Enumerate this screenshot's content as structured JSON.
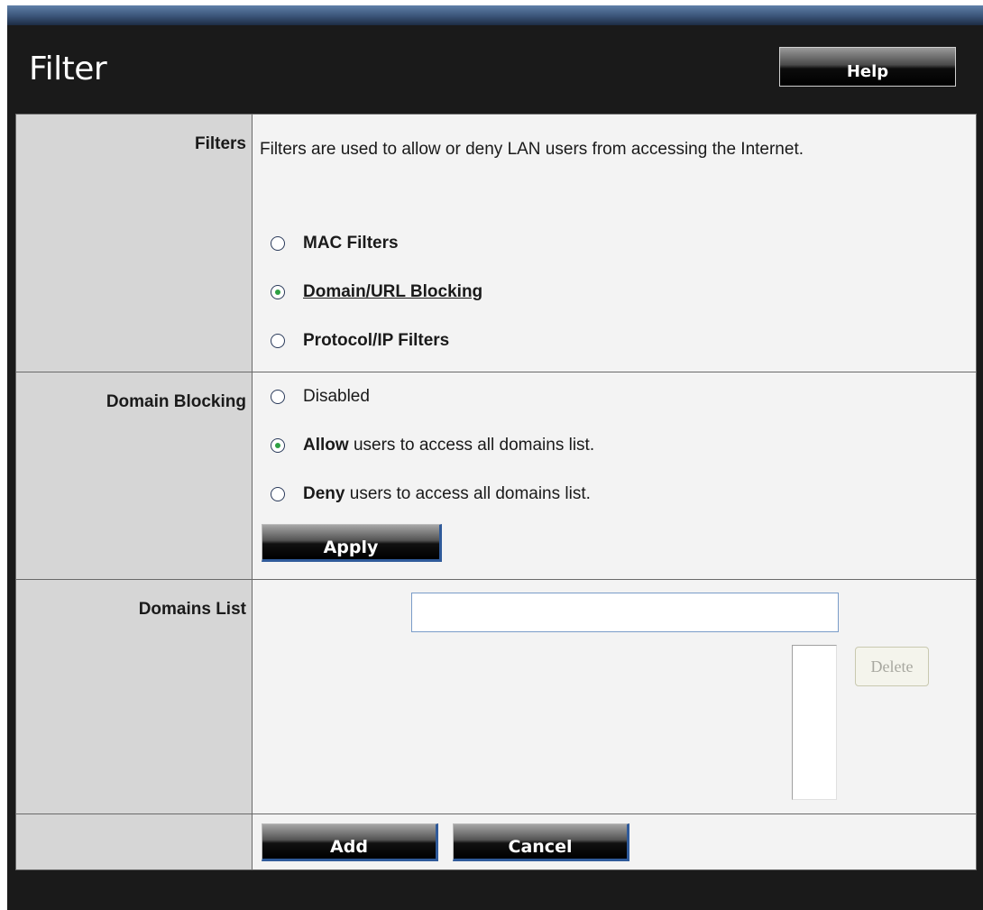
{
  "header": {
    "title": "Filter",
    "help_label": "Help"
  },
  "filters": {
    "label": "Filters",
    "description": "Filters are used to allow or deny LAN users from accessing the Internet.",
    "options": [
      {
        "label": "MAC Filters",
        "checked": false
      },
      {
        "label": "Domain/URL Blocking",
        "checked": true
      },
      {
        "label": "Protocol/IP Filters",
        "checked": false
      }
    ]
  },
  "domain_blocking": {
    "label": "Domain Blocking",
    "disabled_label": "Disabled",
    "allow_bold": "Allow",
    "allow_rest": " users to access all domains list.",
    "deny_bold": "Deny",
    "deny_rest": " users to access all domains list.",
    "selected": "allow",
    "apply_label": "Apply"
  },
  "domains_list": {
    "label": "Domains List",
    "input_value": "",
    "delete_label": "Delete"
  },
  "actions": {
    "add_label": "Add",
    "cancel_label": "Cancel"
  },
  "colors": {
    "header_bg": "#1a1a1a",
    "label_cell_bg": "#d6d6d6",
    "value_cell_bg": "#f3f3f3",
    "radio_dot": "#2ea043"
  }
}
